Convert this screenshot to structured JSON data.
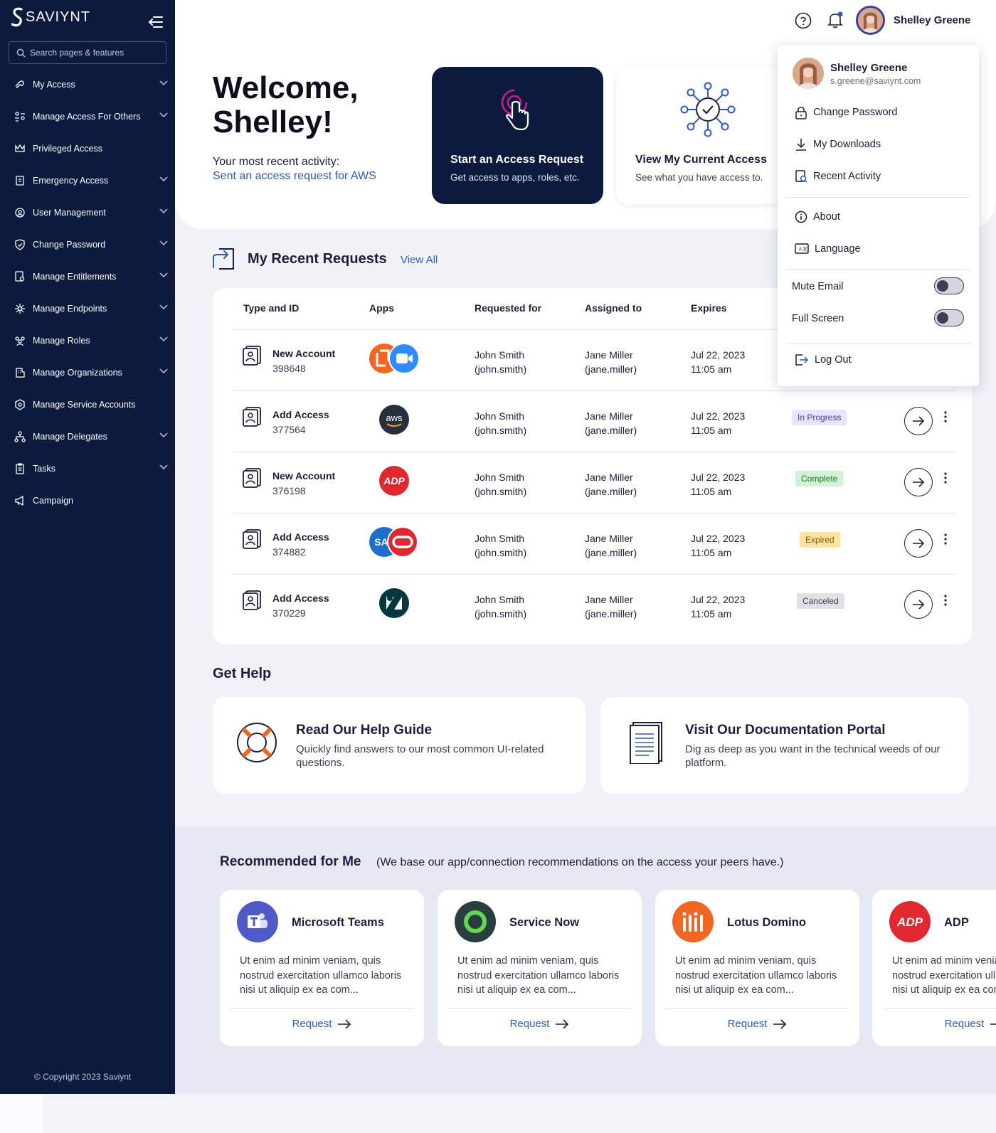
{
  "sidebar": {
    "logo": "SAVIYNT",
    "search_placeholder": "Search pages & features",
    "items": [
      {
        "label": "My Access",
        "chevron": true
      },
      {
        "label": "Manage Access For Others",
        "chevron": true
      },
      {
        "label": "Privileged Access",
        "chevron": false
      },
      {
        "label": "Emergency Access",
        "chevron": true
      },
      {
        "label": "User Management",
        "chevron": true
      },
      {
        "label": "Change Password",
        "chevron": true
      },
      {
        "label": "Manage Entitlements",
        "chevron": true
      },
      {
        "label": "Manage Endpoints",
        "chevron": true
      },
      {
        "label": "Manage Roles",
        "chevron": true
      },
      {
        "label": "Manage Organizations",
        "chevron": true
      },
      {
        "label": "Manage Service Accounts",
        "chevron": false
      },
      {
        "label": "Manage Delegates",
        "chevron": true
      },
      {
        "label": "Tasks",
        "chevron": true
      },
      {
        "label": "Campaign",
        "chevron": false
      }
    ],
    "copyright": "© Copyright 2023 Saviynt"
  },
  "topbar": {
    "user_name": "Shelley Greene"
  },
  "welcome": {
    "title_line1": "Welcome,",
    "title_line2": "Shelley!",
    "recent_label": "Your most recent activity:",
    "recent_link": "Sent an access request for AWS"
  },
  "action_cards": [
    {
      "title": "Start an Access Request",
      "subtitle": "Get access to apps, roles, etc."
    },
    {
      "title": "View My Current Access",
      "subtitle": "See what you have access to."
    }
  ],
  "recent_requests": {
    "title": "My Recent Requests",
    "view_all": "View All",
    "columns": [
      "Type and ID",
      "Apps",
      "Requested for",
      "Assigned to",
      "Expires"
    ],
    "rows": [
      {
        "type": "New Account",
        "id": "398648",
        "apps": [
          "lotus-domino",
          "zoom"
        ],
        "requested_for": "John Smith",
        "requested_for_id": "(john.smith)",
        "assigned_to": "Jane Miller",
        "assigned_to_id": "(jane.miller)",
        "expires_date": "Jul 22, 2023",
        "expires_time": "11:05 am",
        "status": ""
      },
      {
        "type": "Add Access",
        "id": "377564",
        "apps": [
          "aws"
        ],
        "requested_for": "John Smith",
        "requested_for_id": "(john.smith)",
        "assigned_to": "Jane Miller",
        "assigned_to_id": "(jane.miller)",
        "expires_date": "Jul 22, 2023",
        "expires_time": "11:05 am",
        "status": "In Progress"
      },
      {
        "type": "New Account",
        "id": "376198",
        "apps": [
          "adp"
        ],
        "requested_for": "John Smith",
        "requested_for_id": "(john.smith)",
        "assigned_to": "Jane Miller",
        "assigned_to_id": "(jane.miller)",
        "expires_date": "Jul 22, 2023",
        "expires_time": "11:05 am",
        "status": "Complete"
      },
      {
        "type": "Add Access",
        "id": "374882",
        "apps": [
          "sap",
          "oracle"
        ],
        "requested_for": "John Smith",
        "requested_for_id": "(john.smith)",
        "assigned_to": "Jane Miller",
        "assigned_to_id": "(jane.miller)",
        "expires_date": "Jul 22, 2023",
        "expires_time": "11:05 am",
        "status": "Expired"
      },
      {
        "type": "Add Access",
        "id": "370229",
        "apps": [
          "zendesk"
        ],
        "requested_for": "John Smith",
        "requested_for_id": "(john.smith)",
        "assigned_to": "Jane Miller",
        "assigned_to_id": "(jane.miller)",
        "expires_date": "Jul 22, 2023",
        "expires_time": "11:05 am",
        "status": "Canceled"
      }
    ]
  },
  "get_help": {
    "title": "Get Help",
    "cards": [
      {
        "title": "Read Our Help Guide",
        "subtitle": "Quickly find answers to our most common UI-related questions."
      },
      {
        "title": "Visit Our Documentation Portal",
        "subtitle": "Dig as deep as you want in the technical weeds of our platform."
      }
    ]
  },
  "recommended": {
    "title": "Recommended for Me",
    "subtitle": "(We base our app/connection recommendations on the access your peers have.)",
    "cards": [
      {
        "name": "Microsoft Teams",
        "desc": "Ut enim ad minim veniam, quis nostrud exercitation ullamco laboris nisi ut aliquip ex ea com...",
        "action": "Request"
      },
      {
        "name": "Service Now",
        "desc": "Ut enim ad minim veniam, quis nostrud exercitation ullamco laboris nisi ut aliquip ex ea com...",
        "action": "Request"
      },
      {
        "name": "Lotus Domino",
        "desc": "Ut enim ad minim veniam, quis nostrud exercitation ullamco laboris nisi ut aliquip ex ea com...",
        "action": "Request"
      },
      {
        "name": "ADP",
        "desc": "Ut enim ad minim veniam, quis nostrud exercitation ullamco laboris nisi ut aliquip ex ea com...",
        "action": "Request"
      }
    ]
  },
  "dropdown": {
    "name": "Shelley Greene",
    "email": "s.greene@saviynt.com",
    "items_group1": [
      "Change Password",
      "My Downloads",
      "Recent Activity"
    ],
    "items_group2": [
      "About",
      "Language"
    ],
    "toggles": [
      {
        "label": "Mute Email",
        "on": false
      },
      {
        "label": "Full Screen",
        "on": false
      }
    ],
    "logout": "Log Out"
  },
  "colors": {
    "sidebar_bg": "#0c1a3e",
    "accent_blue": "#2b5bbf",
    "accent_magenta": "#d1199b",
    "status_in_progress": "#e9e3fb",
    "status_complete": "#d2f2d4",
    "status_expired": "#fde2a2",
    "status_canceled": "#dfe1e7"
  }
}
